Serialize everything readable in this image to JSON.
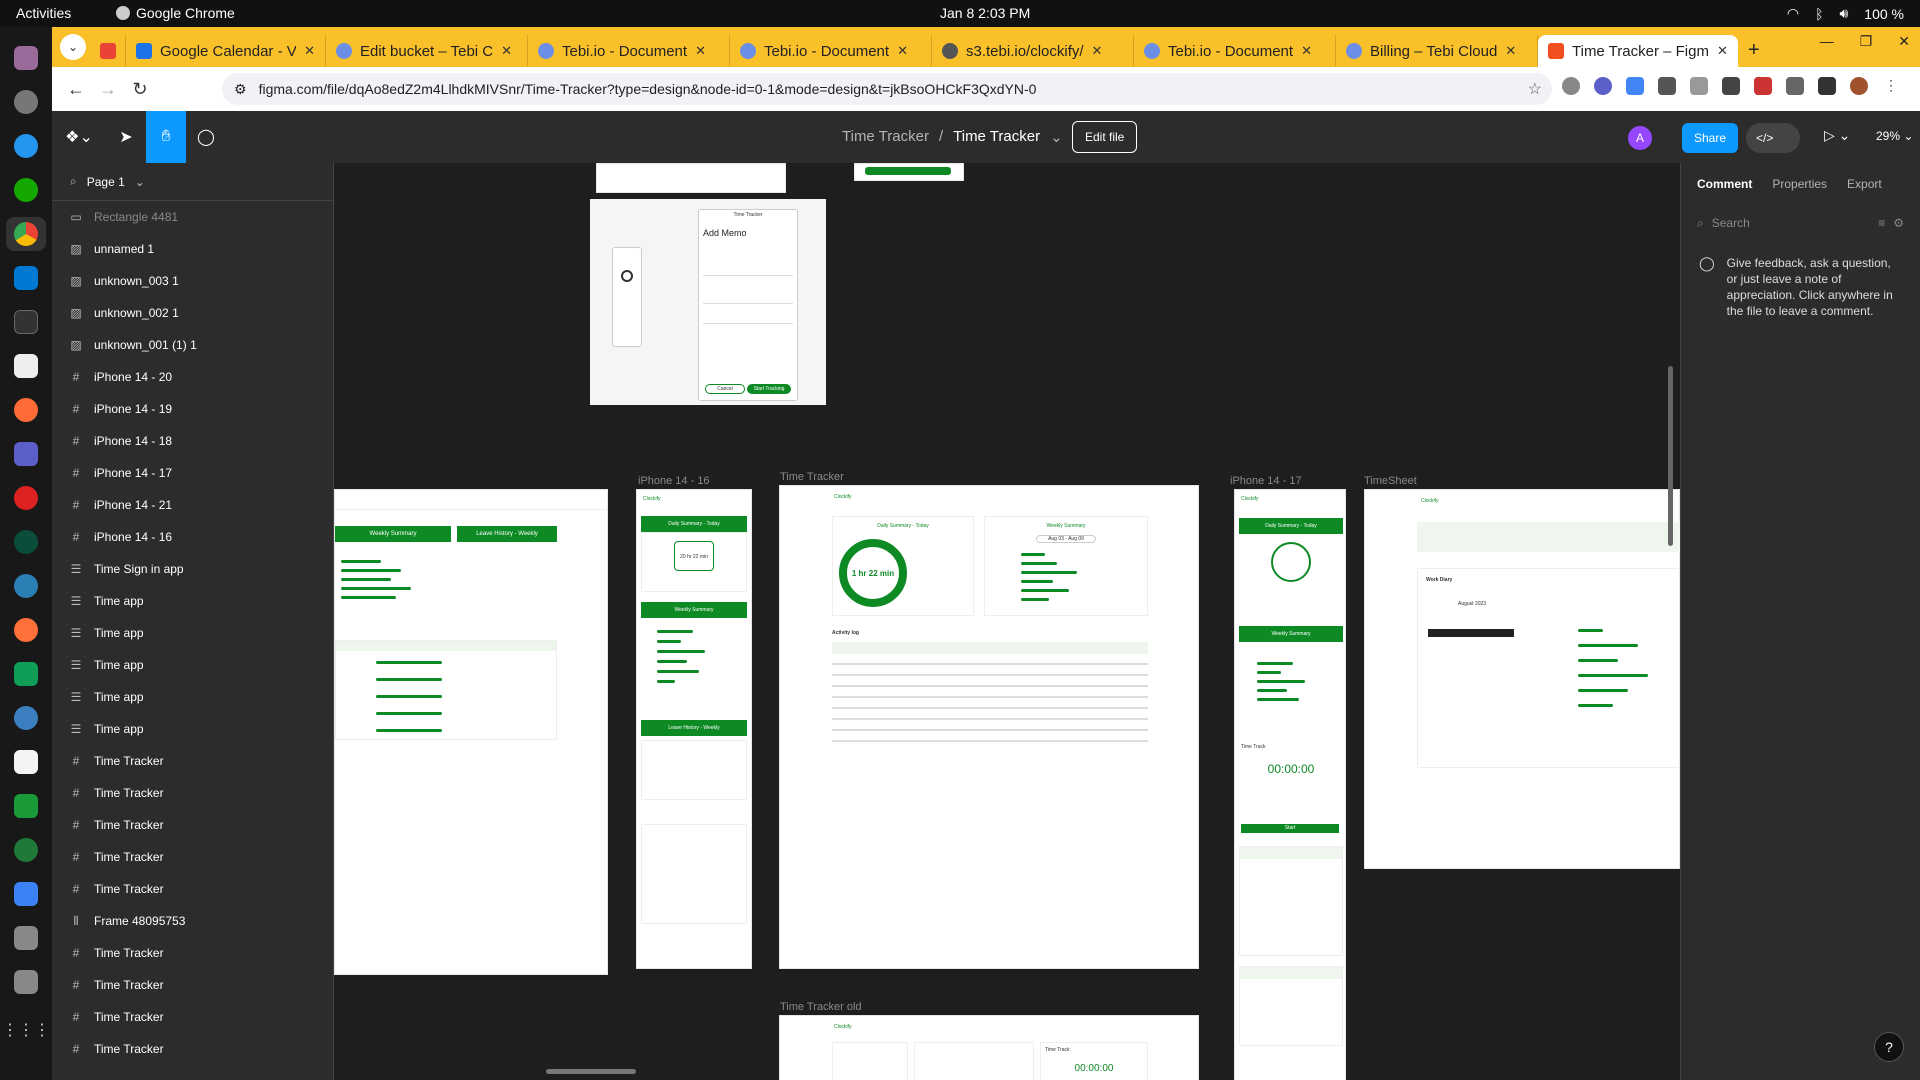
{
  "system": {
    "activities": "Activities",
    "app_name": "Google Chrome",
    "clock": "Jan 8  2:03 PM",
    "battery": "100 %"
  },
  "tabs": [
    {
      "label": "Google Calendar - V",
      "color": "#1a73e8"
    },
    {
      "label": "Edit bucket – Tebi C",
      "color": "#6b8ee6"
    },
    {
      "label": "Tebi.io - Document",
      "color": "#6b8ee6"
    },
    {
      "label": "Tebi.io - Document",
      "color": "#6b8ee6"
    },
    {
      "label": "s3.tebi.io/clockify/",
      "color": "#555555"
    },
    {
      "label": "Tebi.io - Document",
      "color": "#6b8ee6"
    },
    {
      "label": "Billing – Tebi Cloud",
      "color": "#6b8ee6"
    },
    {
      "label": "Time Tracker – Figm",
      "color": "#f24e1e"
    }
  ],
  "address": {
    "url": "figma.com/file/dqAo8edZ2m4LlhdkMIVSnr/Time-Tracker?type=design&node-id=0-1&mode=design&t=jkBsoOHCkF3QxdYN-0"
  },
  "figma": {
    "breadcrumb_project": "Time Tracker",
    "breadcrumb_sep": "/",
    "breadcrumb_file": "Time Tracker",
    "edit_file": "Edit file",
    "avatar_letter": "A",
    "share": "Share",
    "zoom": "29%",
    "page": "Page 1"
  },
  "layers": [
    {
      "name": "Rectangle 4481",
      "icon": "rect",
      "dim": true
    },
    {
      "name": "unnamed 1",
      "icon": "image"
    },
    {
      "name": "unknown_003 1",
      "icon": "image"
    },
    {
      "name": "unknown_002 1",
      "icon": "image"
    },
    {
      "name": "unknown_001 (1) 1",
      "icon": "image"
    },
    {
      "name": "iPhone 14 - 20",
      "icon": "frame"
    },
    {
      "name": "iPhone 14 - 19",
      "icon": "frame"
    },
    {
      "name": "iPhone 14 - 18",
      "icon": "frame"
    },
    {
      "name": "iPhone 14 - 17",
      "icon": "frame"
    },
    {
      "name": "iPhone 14 - 21",
      "icon": "frame"
    },
    {
      "name": "iPhone 14 - 16",
      "icon": "frame"
    },
    {
      "name": "Time Sign in app",
      "icon": "autolayout"
    },
    {
      "name": "Time app",
      "icon": "autolayout"
    },
    {
      "name": "Time app",
      "icon": "autolayout"
    },
    {
      "name": "Time app",
      "icon": "autolayout"
    },
    {
      "name": "Time app",
      "icon": "autolayout"
    },
    {
      "name": "Time app",
      "icon": "autolayout"
    },
    {
      "name": "Time Tracker",
      "icon": "frame"
    },
    {
      "name": "Time Tracker",
      "icon": "frame"
    },
    {
      "name": "Time Tracker",
      "icon": "frame"
    },
    {
      "name": "Time Tracker",
      "icon": "frame"
    },
    {
      "name": "Time Tracker",
      "icon": "frame"
    },
    {
      "name": "Frame 48095753",
      "icon": "columns"
    },
    {
      "name": "Time Tracker",
      "icon": "frame"
    },
    {
      "name": "Time Tracker",
      "icon": "frame"
    },
    {
      "name": "Time Tracker",
      "icon": "frame"
    },
    {
      "name": "Time Tracker",
      "icon": "frame"
    }
  ],
  "canvas": {
    "label_iphone16": "iPhone 14 - 16",
    "label_timetracker": "Time Tracker",
    "label_iphone17": "iPhone 14 - 17",
    "label_timesheet": "TimeSheet",
    "label_timetracker_old": "Time Tracker old",
    "memo_title": "Add Memo",
    "memo_window": "Time Tracker",
    "memo_cancel": "Cancel",
    "memo_start": "Start Tracking",
    "daily_summary": "Daily Summary - Today",
    "weekly_summary": "Weekly Summary",
    "leave_history": "Leave History - Weekly",
    "date_range": "Aug 03 - Aug 09",
    "timer_big": "1 hr 22 min",
    "timer_phone": "20 hr 22 min",
    "timer_clock": "00:00:00",
    "activity_log": "Activity log",
    "work_diary": "Work Diary",
    "calendar_month": "August 2023",
    "start": "Start",
    "time_track": "Time Track",
    "brand": "Clockify"
  },
  "right_panel": {
    "tabs": [
      "Comment",
      "Properties",
      "Export"
    ],
    "search_placeholder": "Search",
    "hint": "Give feedback, ask a question, or just leave a note of appreciation. Click anywhere in the file to leave a comment."
  },
  "colors": {
    "accent": "#0d99ff",
    "design_green": "#0d8a24",
    "chrome_tabbar": "#f9c02a"
  }
}
